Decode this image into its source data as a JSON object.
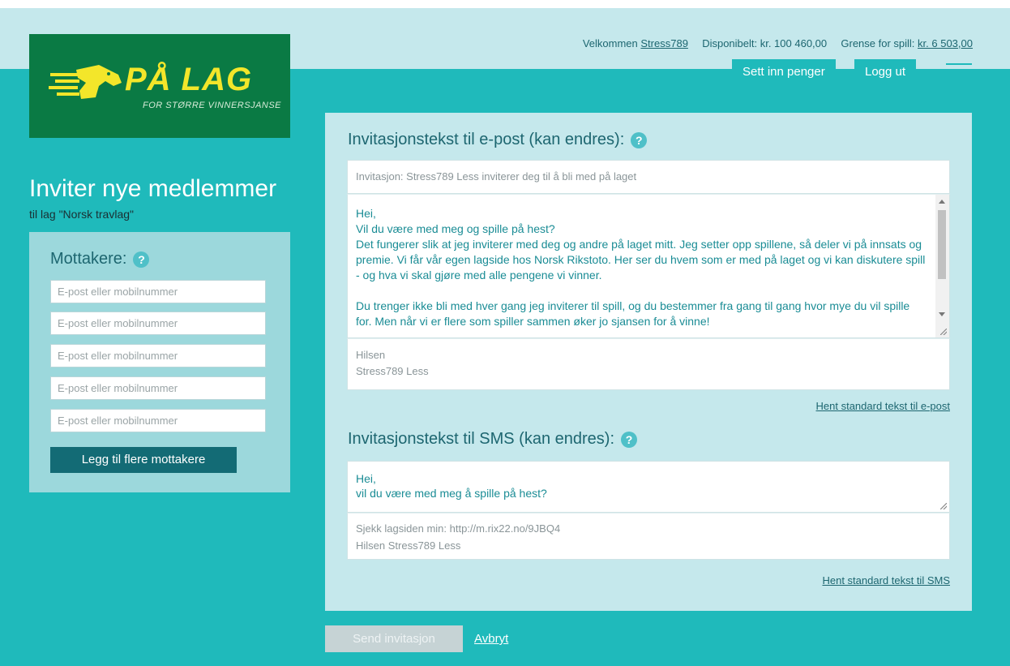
{
  "brand": {
    "name": "PÅ LAG",
    "tagline": "FOR STØRRE VINNERSJANSE"
  },
  "account": {
    "welcome_label": "Velkommen",
    "username": "Stress789",
    "available_label": "Disponibelt: kr. 100 460,00",
    "limit_label": "Grense for spill:",
    "limit_value": "kr. 6 503,00"
  },
  "header_buttons": {
    "deposit": "Sett inn penger",
    "logout": "Logg ut"
  },
  "page": {
    "title": "Inviter nye medlemmer",
    "team_line": "til lag \"Norsk travlag\""
  },
  "recipients": {
    "heading": "Mottakere:",
    "help": "?",
    "placeholder": "E-post eller mobilnummer",
    "add_button": "Legg til flere mottakere"
  },
  "email": {
    "heading": "Invitasjonstekst til e-post (kan endres):",
    "help": "?",
    "subject": "Invitasjon: Stress789 Less inviterer deg til å bli med på laget",
    "body_lines": [
      "Hei,",
      "Vil du være med meg og spille på hest?",
      "Det fungerer slik at jeg inviterer med deg og andre på laget mitt. Jeg setter opp spillene, så deler vi på innsats og premie. Vi får vår egen lagside hos Norsk Rikstoto. Her ser du hvem som er med på laget og vi kan diskutere spill - og hva vi skal gjøre med alle pengene vi vinner.",
      "",
      "Du trenger ikke bli med hver gang jeg inviterer til spill, og du bestemmer fra gang til gang hvor mye du vil spille for. Men når vi er flere som spiller sammen øker jo sjansen for å vinne!"
    ],
    "signature_lines": [
      "Hilsen",
      "Stress789 Less"
    ],
    "reset_link": "Hent standard tekst til e-post"
  },
  "sms": {
    "heading": "Invitasjonstekst til SMS (kan endres):",
    "help": "?",
    "body_lines": [
      "Hei,",
      "vil du være med meg å spille på hest?"
    ],
    "footer_lines": [
      "Sjekk lagsiden min: http://m.rix22.no/9JBQ4",
      "Hilsen Stress789 Less"
    ],
    "reset_link": "Hent standard tekst til SMS"
  },
  "actions": {
    "send": "Send invitasjon",
    "cancel": "Avbryt"
  },
  "colors": {
    "background": "#1fbabb",
    "top_band": "#c5e8ec",
    "logo_green": "#0a7a44",
    "logo_yellow": "#f3e62a",
    "dark_teal": "#136b75",
    "text_teal": "#1a8c95"
  }
}
